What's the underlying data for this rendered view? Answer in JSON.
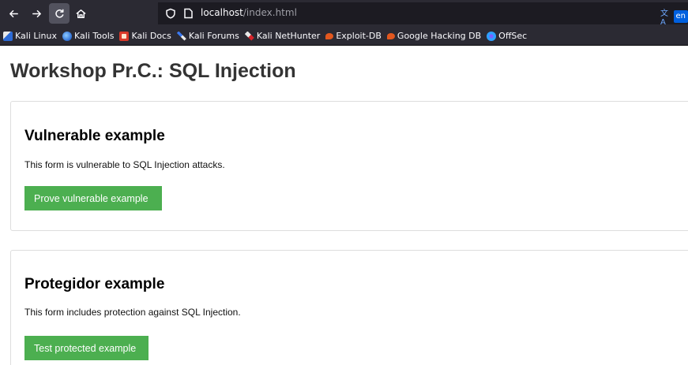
{
  "browser": {
    "url_host": "localhost",
    "url_path": "/index.html",
    "translate_badge": "en",
    "nav_icons": [
      "back-icon",
      "forward-icon",
      "reload-icon",
      "home-icon"
    ]
  },
  "bookmarks": [
    {
      "label": "Kali Linux",
      "icon": "kali-linux-icon"
    },
    {
      "label": "Kali Tools",
      "icon": "kali-tools-icon"
    },
    {
      "label": "Kali Docs",
      "icon": "kali-docs-icon"
    },
    {
      "label": "Kali Forums",
      "icon": "kali-forums-icon"
    },
    {
      "label": "Kali NetHunter",
      "icon": "kali-nethunter-icon"
    },
    {
      "label": "Exploit-DB",
      "icon": "exploit-db-icon"
    },
    {
      "label": "Google Hacking DB",
      "icon": "ghdb-icon"
    },
    {
      "label": "OffSec",
      "icon": "offsec-icon"
    }
  ],
  "page": {
    "title": "Workshop Pr.C.: SQL Injection",
    "vulnerable": {
      "heading": "Vulnerable example",
      "description": "This form is vulnerable to SQL Injection attacks.",
      "button_label": "Prove vulnerable example"
    },
    "protected": {
      "heading": "Protegidor example",
      "description": "This form includes protection against SQL Injection.",
      "button_label": "Test protected example"
    }
  },
  "colors": {
    "button_bg": "#4caf50",
    "toolbar_bg": "#2b2a33",
    "urlbar_bg": "#1c1b22",
    "title_text": "#333333"
  }
}
